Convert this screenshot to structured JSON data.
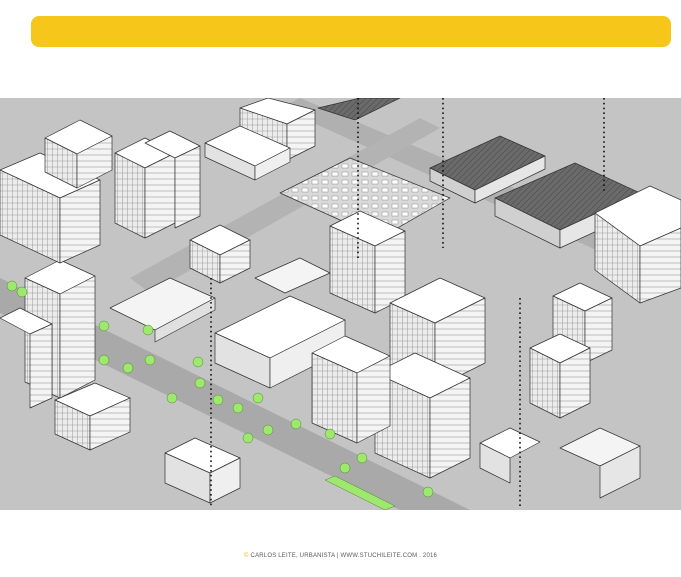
{
  "banner": {
    "color": "#f6c71a"
  },
  "illustration": {
    "palette": {
      "ground": "#bdbdbd",
      "building_top": "#ffffff",
      "building_side": "#e4e4e4",
      "dark_roof": "#666666",
      "tree": "#9fe870",
      "outline": "#333333"
    }
  },
  "credit": {
    "symbol": "©",
    "text": "CARLOS LEITE, URBANISTA | WWW.STUCHILEITE.COM . 2016"
  }
}
